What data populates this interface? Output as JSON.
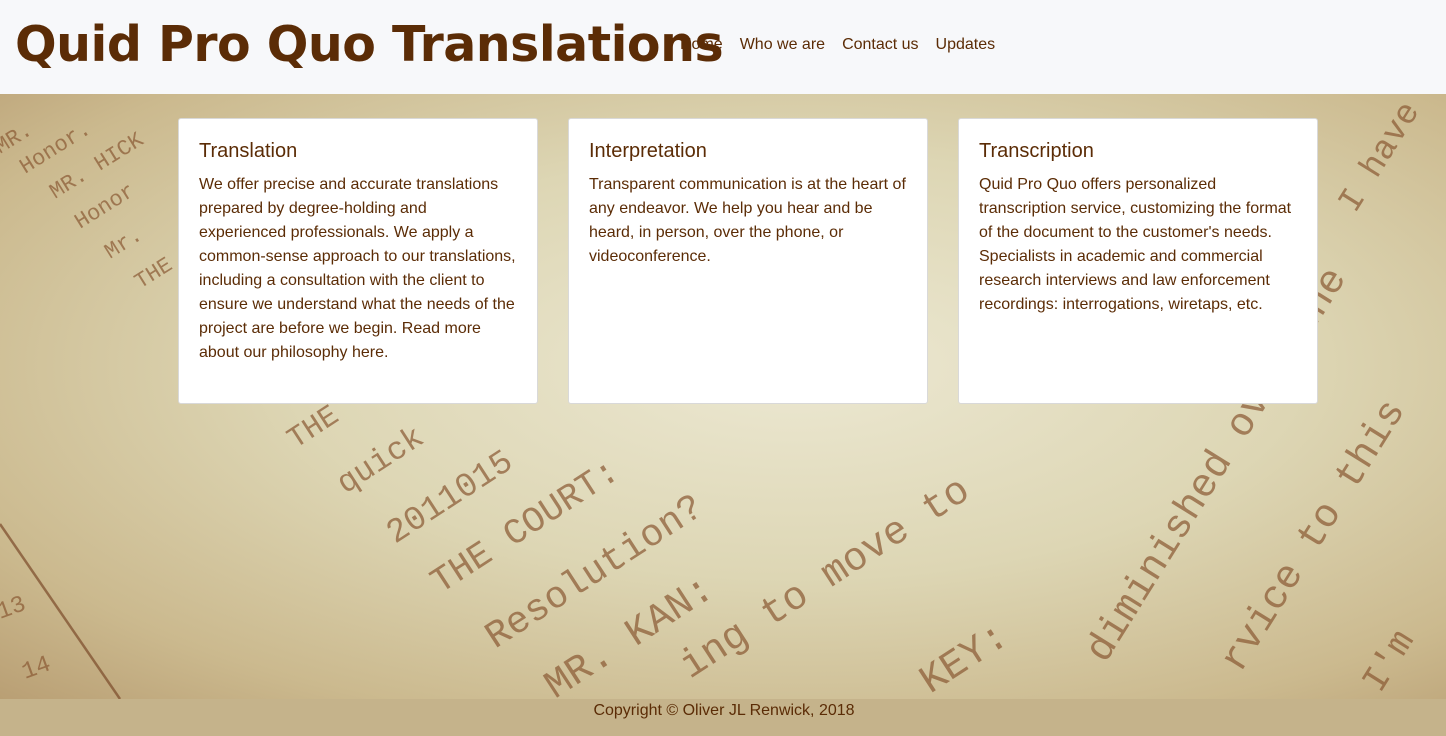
{
  "brand": {
    "title": "Quid Pro Quo Translations"
  },
  "nav": {
    "items": [
      {
        "label": "Home"
      },
      {
        "label": "Who we are"
      },
      {
        "label": "Contact us"
      },
      {
        "label": "Updates"
      }
    ]
  },
  "background": {
    "texts": [
      "MR.",
      "Honor.",
      "MR. HICK",
      "Honor",
      "Mr.",
      "THE",
      "THE",
      "quick",
      "2011015",
      "THE COURT:",
      "Resolution?",
      "MR. KAN:",
      "ing to move to",
      "KEY:",
      "diminished over the",
      "rvice to this",
      "I have a",
      "I'm",
      "13",
      "14"
    ]
  },
  "cards": [
    {
      "title": "Translation",
      "body": "We offer precise and accurate translations prepared by degree-holding and experienced professionals. We apply a common-sense approach to our translations, including a consultation with the client to ensure we understand what the needs of the project are before we begin. Read more about our philosophy here."
    },
    {
      "title": "Interpretation",
      "body": "Transparent communication is at the heart of any endeavor. We help you hear and be heard, in person, over the phone, or videoconference."
    },
    {
      "title": "Transcription",
      "body": "Quid Pro Quo offers personalized transcription service, customizing the format of the document to the customer's needs. Specialists in academic and commercial research interviews and law enforcement recordings: interrogations, wiretaps, etc."
    }
  ],
  "footer": {
    "copyright": "Copyright © Oliver JL Renwick, 2018"
  }
}
